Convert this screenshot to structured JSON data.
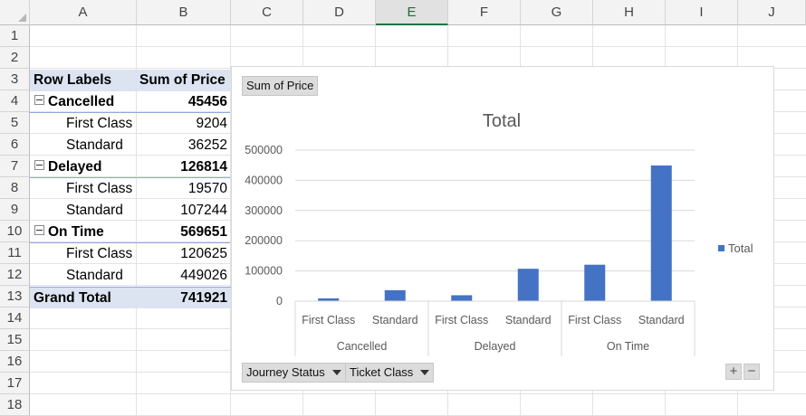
{
  "columns": [
    "A",
    "B",
    "C",
    "D",
    "E",
    "F",
    "G",
    "H",
    "I",
    "J"
  ],
  "selected_column": "E",
  "rows": [
    "1",
    "2",
    "3",
    "4",
    "5",
    "6",
    "7",
    "8",
    "9",
    "10",
    "11",
    "12",
    "13",
    "14",
    "15",
    "16",
    "17",
    "18"
  ],
  "pivot": {
    "header_row_labels": "Row Labels",
    "header_sum": "Sum of Price",
    "rows": [
      {
        "label": "Cancelled",
        "value": "45456",
        "level": 0
      },
      {
        "label": "First Class",
        "value": "9204",
        "level": 1
      },
      {
        "label": "Standard",
        "value": "36252",
        "level": 1
      },
      {
        "label": "Delayed",
        "value": "126814",
        "level": 0
      },
      {
        "label": "First Class",
        "value": "19570",
        "level": 1
      },
      {
        "label": "Standard",
        "value": "107244",
        "level": 1
      },
      {
        "label": "On Time",
        "value": "569651",
        "level": 0
      },
      {
        "label": "First Class",
        "value": "120625",
        "level": 1
      },
      {
        "label": "Standard",
        "value": "449026",
        "level": 1
      }
    ],
    "grand_total_label": "Grand Total",
    "grand_total_value": "741921"
  },
  "chart": {
    "value_field_button": "Sum of Price",
    "axis_field_buttons": [
      "Journey Status",
      "Ticket Class"
    ],
    "zoom_buttons": [
      "+",
      "−"
    ]
  },
  "chart_data": {
    "type": "bar",
    "title": "Total",
    "categories": [
      "First Class",
      "Standard",
      "First Class",
      "Standard",
      "First Class",
      "Standard"
    ],
    "groups": [
      "Cancelled",
      "Delayed",
      "On Time"
    ],
    "series": [
      {
        "name": "Total",
        "values": [
          9204,
          36252,
          19570,
          107244,
          120625,
          449026
        ],
        "color": "#4472c4"
      }
    ],
    "yticks": [
      "500000",
      "400000",
      "300000",
      "200000",
      "100000",
      "0"
    ],
    "ylim": [
      0,
      500000
    ],
    "legend": "right",
    "grid": true
  },
  "colors": {
    "bar": "#4472c4",
    "pivot_header": "#dce3f1",
    "selected_column": "#217346"
  }
}
